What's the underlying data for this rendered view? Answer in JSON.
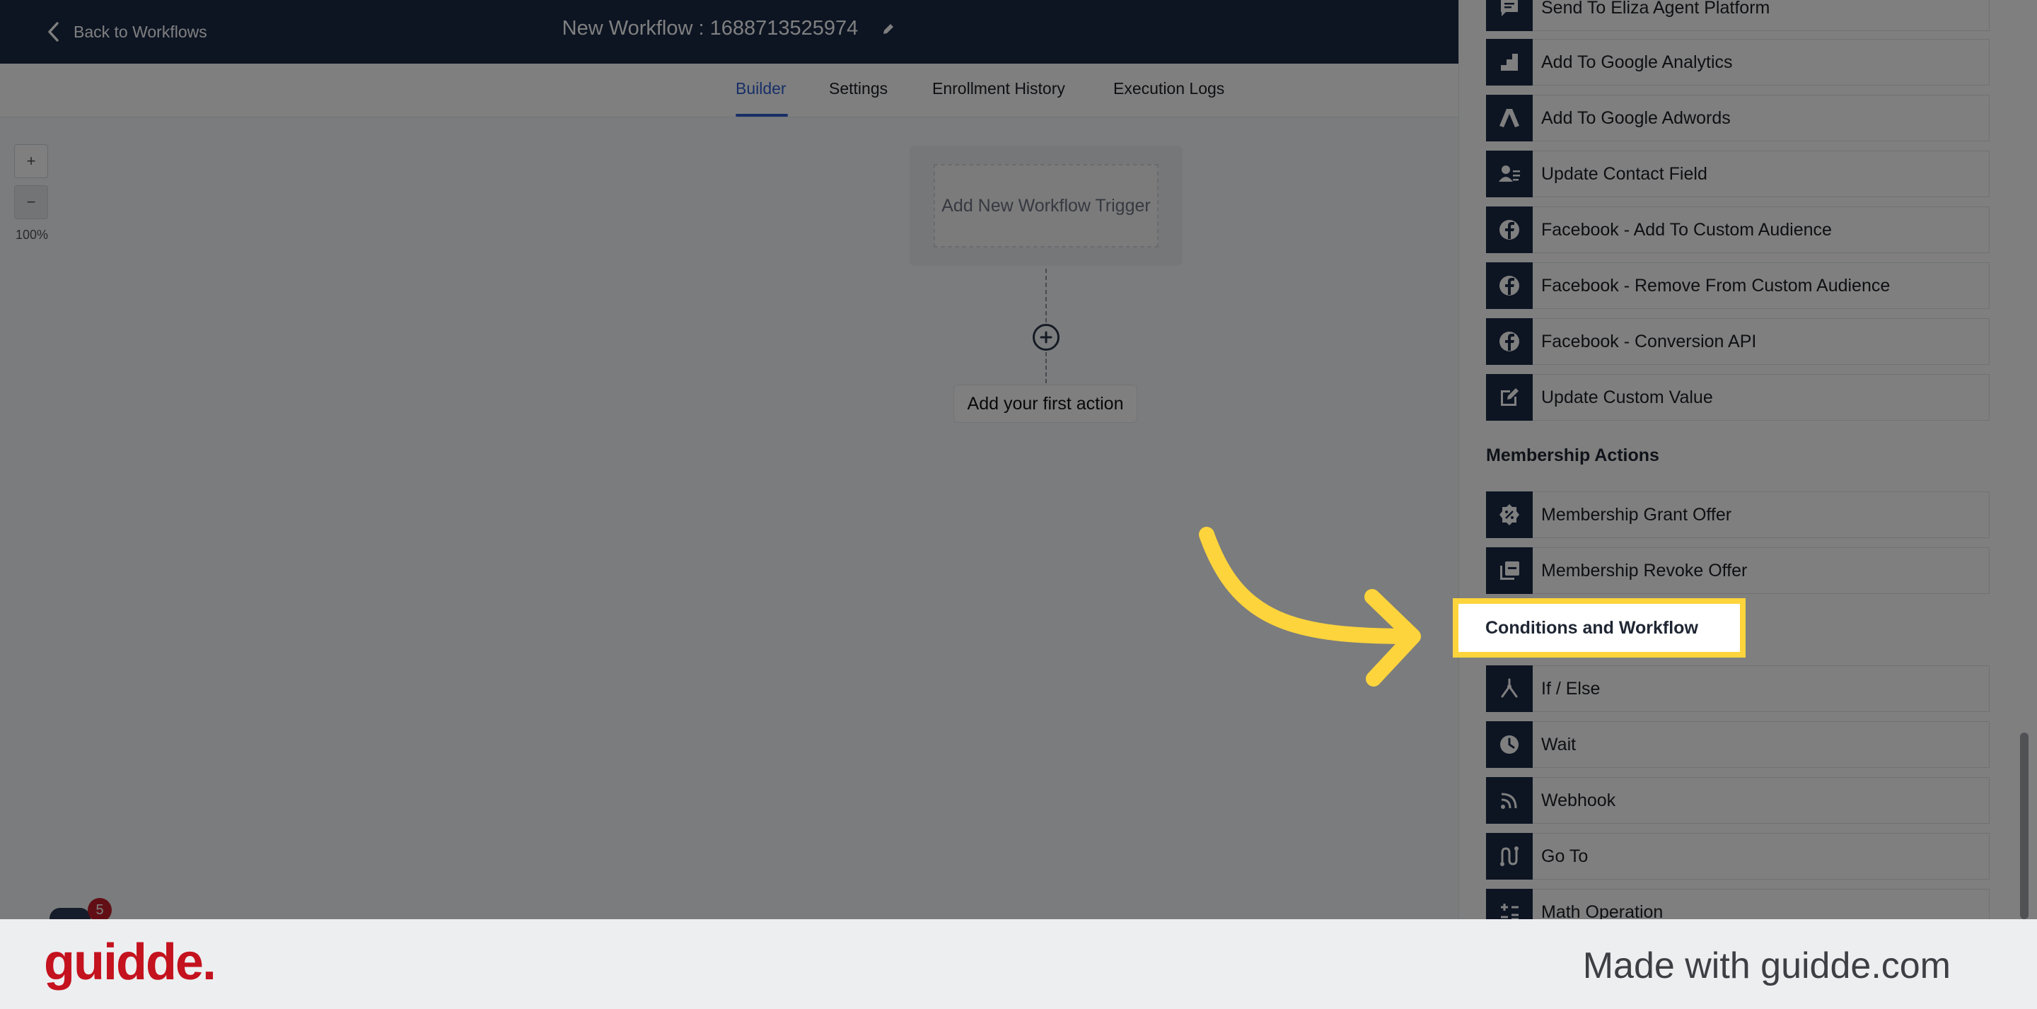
{
  "topbar": {
    "back_label": "Back to Workflows",
    "title": "New Workflow : 1688713525974"
  },
  "tabs": [
    {
      "label": "Builder",
      "active": true
    },
    {
      "label": "Settings",
      "active": false
    },
    {
      "label": "Enrollment History",
      "active": false
    },
    {
      "label": "Execution Logs",
      "active": false
    }
  ],
  "canvas": {
    "zoom_in_label": "+",
    "zoom_out_label": "−",
    "zoom_level": "100%",
    "trigger_label": "Add New Workflow Trigger",
    "first_action_label": "Add your first action",
    "notification_count": "5"
  },
  "sidebar": {
    "top_items": [
      {
        "label": "Send To Eliza Agent Platform",
        "icon": "chat-icon"
      },
      {
        "label": "Add To Google Analytics",
        "icon": "analytics-icon"
      },
      {
        "label": "Add To Google Adwords",
        "icon": "adwords-icon"
      },
      {
        "label": "Update Contact Field",
        "icon": "contact-card-icon"
      },
      {
        "label": "Facebook - Add To Custom Audience",
        "icon": "facebook-icon"
      },
      {
        "label": "Facebook - Remove From Custom Audience",
        "icon": "facebook-icon"
      },
      {
        "label": "Facebook - Conversion API",
        "icon": "facebook-icon"
      },
      {
        "label": "Update Custom Value",
        "icon": "edit-icon"
      }
    ],
    "membership_header": "Membership Actions",
    "membership_items": [
      {
        "label": "Membership Grant Offer",
        "icon": "badge-icon"
      },
      {
        "label": "Membership Revoke Offer",
        "icon": "stack-icon"
      }
    ],
    "conditions_header": "Conditions and Workflow",
    "conditions_items": [
      {
        "label": "If / Else",
        "icon": "split-icon"
      },
      {
        "label": "Wait",
        "icon": "clock-icon"
      },
      {
        "label": "Webhook",
        "icon": "rss-icon"
      },
      {
        "label": "Go To",
        "icon": "route-icon"
      },
      {
        "label": "Math Operation",
        "icon": "math-icon"
      }
    ]
  },
  "footer": {
    "brand": "guidde.",
    "made_with": "Made with guidde.com"
  },
  "colors": {
    "nav_dark": "#1b2a47",
    "accent_blue": "#2f5fd0",
    "highlight_yellow": "#fdd43c",
    "brand_red": "#c4121e"
  }
}
